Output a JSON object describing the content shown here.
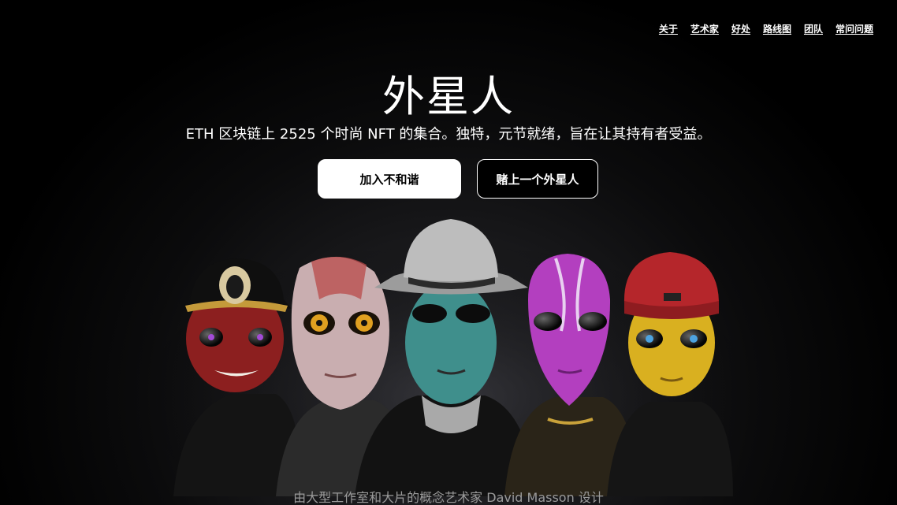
{
  "nav": {
    "items": [
      {
        "label": "关于"
      },
      {
        "label": "艺术家"
      },
      {
        "label": "好处"
      },
      {
        "label": "路线图"
      },
      {
        "label": "团队"
      },
      {
        "label": "常问问题"
      }
    ]
  },
  "hero": {
    "title": "外星人",
    "subtitle": "ETH 区块链上 2525 个时尚 NFT 的集合。独特，元节就绪，旨在让其持有者受益。",
    "primary_button": "加入不和谐",
    "secondary_button": "赌上一个外星人"
  },
  "artwork": {
    "characters": [
      {
        "name": "red-alien-cap",
        "skin": "#8c1f1f",
        "accent": "#111111"
      },
      {
        "name": "pale-alien-spotted",
        "skin": "#c9aeb0",
        "accent": "#b84a4a"
      },
      {
        "name": "teal-alien-cowboy-hat",
        "skin": "#3f8f8c",
        "accent": "#bdbdbd"
      },
      {
        "name": "purple-alien",
        "skin": "#b33fbf",
        "accent": "#e8d0f0"
      },
      {
        "name": "yellow-alien-beanie",
        "skin": "#d9b020",
        "accent": "#b5262b"
      }
    ]
  },
  "footer": {
    "credit": "由大型工作室和大片的概念艺术家 David Masson 设计"
  }
}
